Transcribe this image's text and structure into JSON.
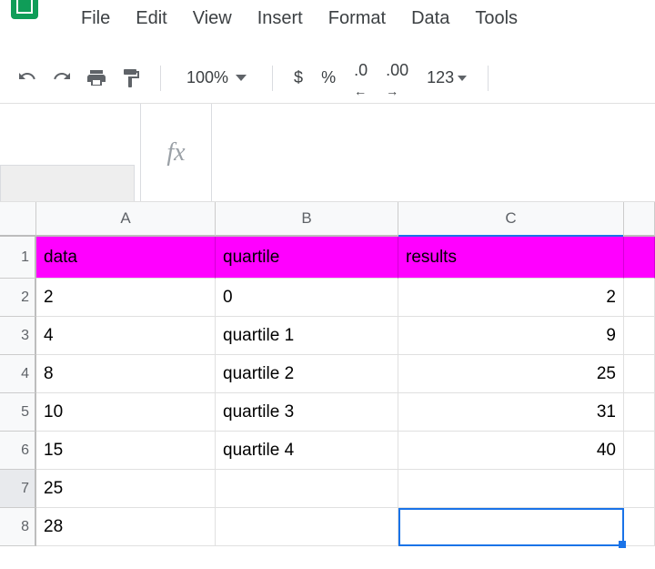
{
  "menubar": [
    "File",
    "Edit",
    "View",
    "Insert",
    "Format",
    "Data",
    "Tools"
  ],
  "toolbar": {
    "zoom": "100%",
    "currency": "$",
    "percent": "%",
    "dec_less": ".0",
    "dec_more": ".00",
    "num_fmt": "123"
  },
  "fx": {
    "label": "fx",
    "value": ""
  },
  "columns": [
    "A",
    "B",
    "C"
  ],
  "rows": [
    "1",
    "2",
    "3",
    "4",
    "5",
    "6",
    "7",
    "8"
  ],
  "cells": {
    "A1": "data",
    "B1": "quartile",
    "C1": "results",
    "A2": "2",
    "B2": "0",
    "C2": "2",
    "A3": "4",
    "B3": "quartile 1",
    "C3": "9",
    "A4": "8",
    "B4": "quartile 2",
    "C4": "25",
    "A5": "10",
    "B5": "quartile 3",
    "C5": "31",
    "A6": "15",
    "B6": "quartile 4",
    "C6": "40",
    "A7": "25",
    "A8": "28"
  },
  "selection": {
    "cell": "C7"
  },
  "colors": {
    "header_fill": "#ff00ff",
    "selection": "#1a73e8"
  }
}
